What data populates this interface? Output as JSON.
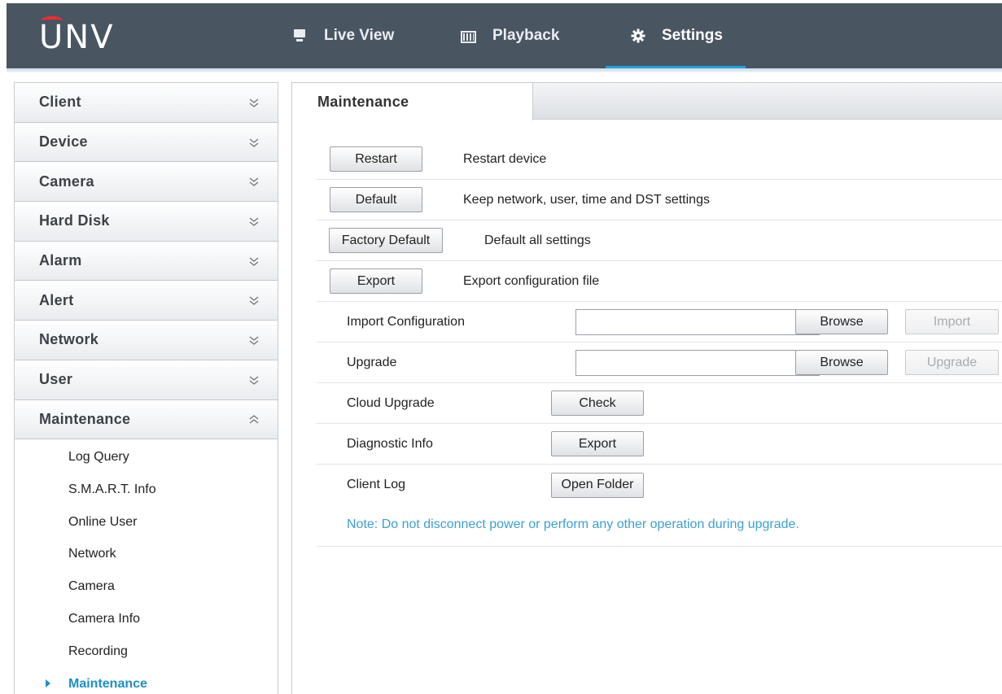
{
  "brand": {
    "logo_text": "UNV",
    "accent_color": "#1fa3d9",
    "logo_accent_color": "#ff2a2a"
  },
  "nav": {
    "tabs": [
      {
        "label": "Live View",
        "icon": "monitor-icon",
        "active": false
      },
      {
        "label": "Playback",
        "icon": "film-icon",
        "active": false
      },
      {
        "label": "Settings",
        "icon": "gear-icon",
        "active": true
      }
    ]
  },
  "sidebar": {
    "groups": [
      {
        "label": "Client",
        "expanded": false
      },
      {
        "label": "Device",
        "expanded": false
      },
      {
        "label": "Camera",
        "expanded": false
      },
      {
        "label": "Hard Disk",
        "expanded": false
      },
      {
        "label": "Alarm",
        "expanded": false
      },
      {
        "label": "Alert",
        "expanded": false
      },
      {
        "label": "Network",
        "expanded": false
      },
      {
        "label": "User",
        "expanded": false
      },
      {
        "label": "Maintenance",
        "expanded": true
      }
    ],
    "maintenance_items": [
      {
        "label": "Log Query"
      },
      {
        "label": "S.M.A.R.T. Info"
      },
      {
        "label": "Online User"
      },
      {
        "label": "Network"
      },
      {
        "label": "Camera"
      },
      {
        "label": "Camera Info"
      },
      {
        "label": "Recording"
      },
      {
        "label": "Maintenance",
        "active": true
      }
    ]
  },
  "main": {
    "tab_title": "Maintenance",
    "actions": [
      {
        "button": "Restart",
        "description": "Restart device"
      },
      {
        "button": "Default",
        "description": "Keep network, user, time and DST settings"
      },
      {
        "button": "Factory Default",
        "description": "Default all settings"
      },
      {
        "button": "Export",
        "description": "Export configuration file"
      }
    ],
    "import_config": {
      "label": "Import Configuration",
      "value": "",
      "browse": "Browse",
      "action": "Import",
      "action_enabled": false
    },
    "upgrade": {
      "label": "Upgrade",
      "value": "",
      "browse": "Browse",
      "action": "Upgrade",
      "action_enabled": false
    },
    "cloud_upgrade": {
      "label": "Cloud Upgrade",
      "button": "Check"
    },
    "diagnostic_info": {
      "label": "Diagnostic Info",
      "button": "Export"
    },
    "client_log": {
      "label": "Client Log",
      "button": "Open Folder"
    },
    "note": "Note: Do not disconnect power or perform any other operation during upgrade.",
    "note_color": "#3aa0d4"
  }
}
